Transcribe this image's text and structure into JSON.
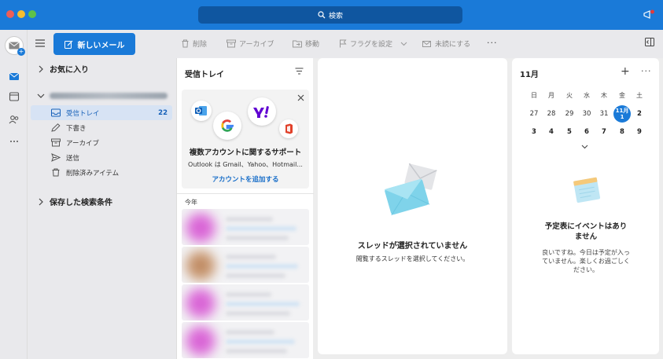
{
  "titlebar": {
    "search_label": "検索"
  },
  "toolbar": {
    "new_mail_label": "新しいメール",
    "delete_label": "削除",
    "archive_label": "アーカイブ",
    "move_label": "移動",
    "flag_label": "フラグを設定",
    "unread_label": "未読にする",
    "more_label": "···"
  },
  "folders": {
    "favorites_label": "お気に入り",
    "items": [
      {
        "label": "受信トレイ",
        "count": "22",
        "icon": "inbox-icon"
      },
      {
        "label": "下書き",
        "icon": "pencil-icon"
      },
      {
        "label": "アーカイブ",
        "icon": "archive-icon"
      },
      {
        "label": "送信",
        "icon": "send-icon"
      },
      {
        "label": "削除済みアイテム",
        "icon": "trash-icon"
      }
    ],
    "saved_searches_label": "保存した検索条件"
  },
  "message_list": {
    "title": "受信トレイ",
    "promo": {
      "title": "複数アカウントに関するサポート",
      "subtitle": "Outlook は Gmail、Yahoo、Hotmail...",
      "link": "アカウントを追加する"
    },
    "year_label": "今年"
  },
  "reading_pane": {
    "title": "スレッドが選択されていません",
    "subtitle": "閲覧するスレッドを選択してください。"
  },
  "calendar": {
    "month": "11月",
    "weekdays": [
      "日",
      "月",
      "火",
      "水",
      "木",
      "金",
      "土"
    ],
    "week1": [
      "27",
      "28",
      "29",
      "30",
      "31",
      "11月",
      "2"
    ],
    "today_day": "1",
    "week2": [
      "3",
      "4",
      "5",
      "6",
      "7",
      "8",
      "9"
    ],
    "empty_title_line1": "予定表にイベントはあり",
    "empty_title_line2": "ません",
    "empty_sub_line1": "良いですね。今日は予定が入っ",
    "empty_sub_line2": "ていません。楽しくお過ごしく",
    "empty_sub_line3": "ださい。"
  },
  "colors": {
    "accent": "#1a7ad8",
    "selected_folder_bg": "#d7e3f4",
    "pane_bg": "#e9e9ec"
  }
}
